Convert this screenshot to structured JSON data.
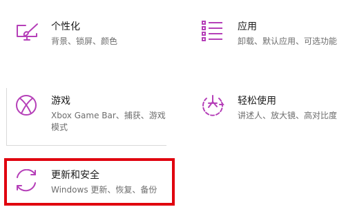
{
  "accent_color": "#b53fb8",
  "highlight_color": "#e0000e",
  "tiles": [
    {
      "id": "personalization",
      "icon": "paint-monitor-icon",
      "title": "个性化",
      "description": "背景、锁屏、颜色"
    },
    {
      "id": "apps",
      "icon": "app-list-icon",
      "title": "应用",
      "description": "卸载、默认应用、可选功能"
    },
    {
      "id": "gaming",
      "icon": "xbox-icon",
      "title": "游戏",
      "description": "Xbox Game Bar、捕获、游戏模式"
    },
    {
      "id": "ease_of_access",
      "icon": "ease-of-access-icon",
      "title": "轻松使用",
      "description": "讲述人、放大镜、高对比度"
    },
    {
      "id": "update_security",
      "icon": "sync-arrows-icon",
      "title": "更新和安全",
      "description": "Windows 更新、恢复、备份"
    }
  ]
}
